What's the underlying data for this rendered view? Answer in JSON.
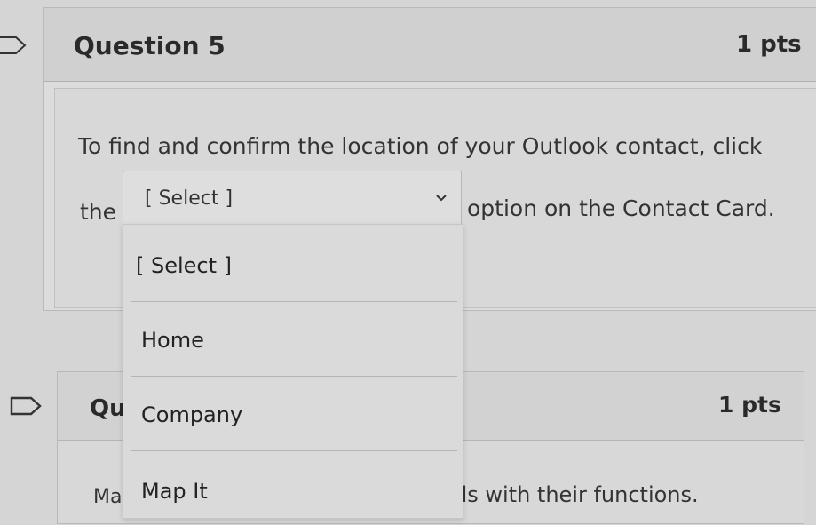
{
  "question5": {
    "title": "Question 5",
    "points": "1 pts",
    "prompt_line1": "To find and confirm the location of your Outlook contact, click",
    "prompt_before": "the",
    "prompt_after": "option on the Contact Card.",
    "select": {
      "value": "[ Select ]",
      "options": [
        "[ Select ]",
        "Home",
        "Company",
        "Map It"
      ]
    }
  },
  "question6": {
    "title_partial": "Qu",
    "points": "1 pts",
    "body_partial_left": "Mat",
    "body_partial_right": "ds with their functions."
  },
  "colors": {
    "background": "#d5d5d5",
    "card": "#dcdcdc",
    "text": "#333333"
  }
}
